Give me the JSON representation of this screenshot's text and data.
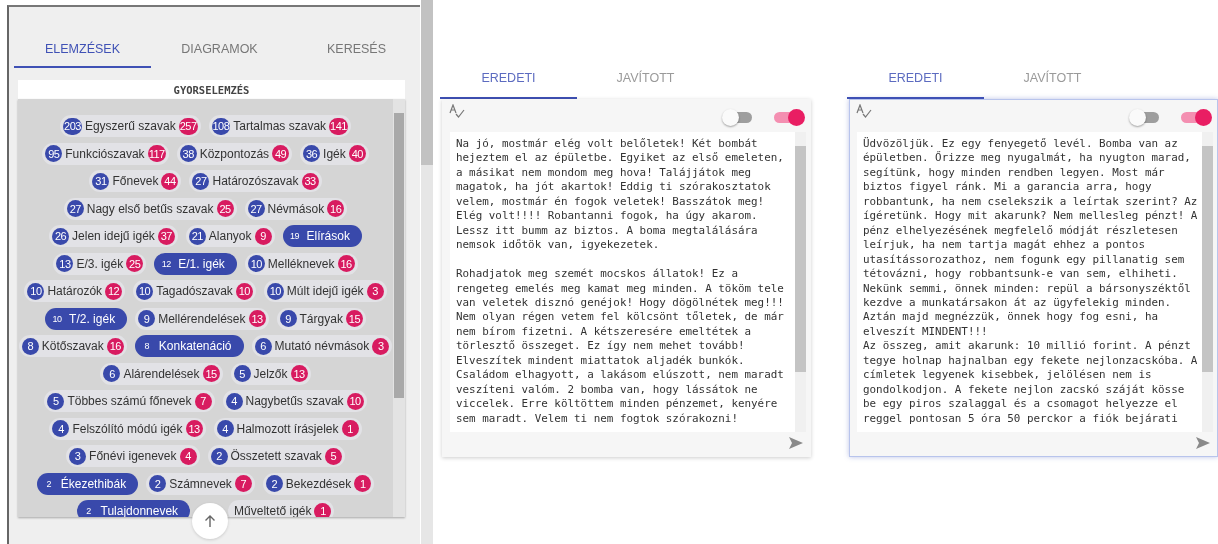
{
  "left_tabs": [
    {
      "label": "ELEMZÉSEK",
      "selected": true
    },
    {
      "label": "DIAGRAMOK",
      "selected": false
    },
    {
      "label": "KERESÉS",
      "selected": false
    }
  ],
  "quick_analysis": {
    "title": "GYORSELEMZÉS",
    "chip_rows": [
      {
        "chips": [
          {
            "count": "203",
            "label": "Egyszerű szavak",
            "badge": "257",
            "selected": false
          },
          {
            "count": "108",
            "label": "Tartalmas szavak",
            "badge": "141",
            "selected": false
          }
        ]
      },
      {
        "chips": [
          {
            "count": "95",
            "label": "Funkciószavak",
            "badge": "117",
            "selected": false
          },
          {
            "count": "38",
            "label": "Központozás",
            "badge": "49",
            "selected": false
          },
          {
            "count": "36",
            "label": "Igék",
            "badge": "40",
            "selected": false
          }
        ]
      },
      {
        "chips": [
          {
            "count": "31",
            "label": "Főnevek",
            "badge": "44",
            "selected": false
          },
          {
            "count": "27",
            "label": "Határozószavak",
            "badge": "33",
            "selected": false
          }
        ]
      },
      {
        "chips": [
          {
            "count": "27",
            "label": "Nagy első betűs szavak",
            "badge": "25",
            "selected": false
          },
          {
            "count": "27",
            "label": "Névmások",
            "badge": "16",
            "selected": false
          }
        ]
      },
      {
        "chips": [
          {
            "count": "26",
            "label": "Jelen idejű igék",
            "badge": "37",
            "selected": false
          },
          {
            "count": "21",
            "label": "Alanyok",
            "badge": "9",
            "selected": false
          },
          {
            "count": "19",
            "label": "Elírások",
            "selected": true
          }
        ]
      },
      {
        "chips": [
          {
            "count": "13",
            "label": "E/3. igék",
            "badge": "25",
            "selected": false
          },
          {
            "count": "12",
            "label": "E/1. igék",
            "selected": true
          },
          {
            "count": "10",
            "label": "Melléknevek",
            "badge": "16",
            "selected": false
          }
        ]
      },
      {
        "chips": [
          {
            "count": "10",
            "label": "Határozók",
            "badge": "12",
            "selected": false
          },
          {
            "count": "10",
            "label": "Tagadószavak",
            "badge": "10",
            "selected": false
          },
          {
            "count": "10",
            "label": "Múlt idejű igék",
            "badge": "3",
            "selected": false
          }
        ]
      },
      {
        "chips": [
          {
            "count": "10",
            "label": "T/2. igék",
            "selected": true
          },
          {
            "count": "9",
            "label": "Mellérendelések",
            "badge": "13",
            "selected": false
          },
          {
            "count": "9",
            "label": "Tárgyak",
            "badge": "15",
            "selected": false
          }
        ]
      },
      {
        "chips": [
          {
            "count": "8",
            "label": "Kötőszavak",
            "badge": "16",
            "selected": false
          },
          {
            "count": "8",
            "label": "Konkatenáció",
            "selected": true
          },
          {
            "count": "6",
            "label": "Mutató névmások",
            "badge": "3",
            "selected": false
          }
        ]
      },
      {
        "chips": [
          {
            "count": "6",
            "label": "Alárendelések",
            "badge": "15",
            "selected": false
          },
          {
            "count": "5",
            "label": "Jelzők",
            "badge": "13",
            "selected": false
          }
        ]
      },
      {
        "chips": [
          {
            "count": "5",
            "label": "Többes számú főnevek",
            "badge": "7",
            "selected": false
          },
          {
            "count": "4",
            "label": "Nagybetűs szavak",
            "badge": "10",
            "selected": false
          }
        ]
      },
      {
        "chips": [
          {
            "count": "4",
            "label": "Felszólító módú igék",
            "badge": "13",
            "selected": false
          },
          {
            "count": "4",
            "label": "Halmozott írásjelek",
            "badge": "1",
            "selected": false
          }
        ]
      },
      {
        "chips": [
          {
            "count": "3",
            "label": "Főnévi igenevek",
            "badge": "4",
            "selected": false
          },
          {
            "count": "2",
            "label": "Összetett szavak",
            "badge": "5",
            "selected": false
          }
        ]
      },
      {
        "chips": [
          {
            "count": "2",
            "label": "Ékezethibák",
            "selected": true
          },
          {
            "count": "2",
            "label": "Számnevek",
            "badge": "7",
            "selected": false
          },
          {
            "count": "2",
            "label": "Bekezdések",
            "badge": "1",
            "selected": false
          }
        ]
      },
      {
        "chips": [
          {
            "count": "2",
            "label": "Tulajdonnevek",
            "selected": true
          },
          {
            "label": "Műveltető igék",
            "badge": "1",
            "selected": false
          }
        ]
      }
    ]
  },
  "editors": [
    {
      "focused": false,
      "tabs": [
        {
          "label": "EREDETI",
          "selected": true
        },
        {
          "label": "JAVÍTOTT",
          "selected": false
        }
      ],
      "toggles": [
        {
          "on": false
        },
        {
          "on": true
        }
      ],
      "text": "Na jó, mostmár elég volt belőletek! Két bombát\nhejeztem el az épületbe. Egyiket az első emeleten,\na másikat nem mondom meg hova! Talájjátok meg\nmagatok, ha jót akartok! Eddig ti szórakosztatok\nvelem, mostmár én fogok veletek! Basszátok meg!\nElég volt!!!! Robantanni fogok, ha úgy akarom.\nLessz itt bumm az biztos. A boma megtalálására\nnemsok időtök van, igyekezetek.\n\nRohadjatok meg szemét mocskos állatok! Ez a\nrengeteg emelés meg kamat meg minden. A tököm tele\nvan veletek disznó genéjok! Hogy dögölnétek meg!!!\nNem olyan régen vetem fel kölcsönt tőletek, de már\nnem bírom fizetni. A kétszeresére emeltétek a\ntörlesztő összeget. Ez így nem mehet tovább!\nElveszítek mindent miattatok aljadék bunkók.\nCsaládom elhagyott, a lakásom elúszott, nem maradt\nveszíteni valóm. 2 bomba van, hogy lássátok ne\nviccelek. Erre költöttem minden pénzemet, kenyére\nsem maradt. Velem ti nem fogtok szórakozni!"
    },
    {
      "focused": true,
      "tabs": [
        {
          "label": "EREDETI",
          "selected": true
        },
        {
          "label": "JAVÍTOTT",
          "selected": false
        }
      ],
      "toggles": [
        {
          "on": false
        },
        {
          "on": true
        }
      ],
      "text": "Üdvözöljük. Ez egy fenyegető levél. Bomba van az\népületben. Őrizze meg nyugalmát, ha nyugton marad,\nsegítünk, hogy minden rendben legyen. Most már\nbiztos figyel ránk. Mi a garancia arra, hogy\nrobbantunk, ha nem cselekszik a leírtak szerint? Az\nígéretünk. Hogy mit akarunk? Nem mellesleg pénzt! A\npénz elhelyezésének megfelelő módját részletesen\nleírjuk, ha nem tartja magát ehhez a pontos\nutasítássorozathoz, nem fogunk egy pillanatig sem\ntétovázni, hogy robbantsunk-e van sem, elhiheti.\nNekünk semmi, önnek minden: repül a bársonyszéktől\nkezdve a munkatársakon át az ügyfelekig minden.\nAztán majd megnézzük, önnek hogy fog esni, ha\nelveszít MINDENT!!!\nAz összeg, amit akarunk: 10 millió forint. A pénzt\ntegye holnap hajnalban egy fekete nejlonzacskóba. A\ncímletek legyenek kisebbek, jelölésen nem is\ngondolkodjon. A fekete nejlon zacskó száját kösse\nbe egy piros szalaggal és a csomagot helyezze el\nreggel pontosan 5 óra 50 perckor a fiók bejárati"
    }
  ]
}
